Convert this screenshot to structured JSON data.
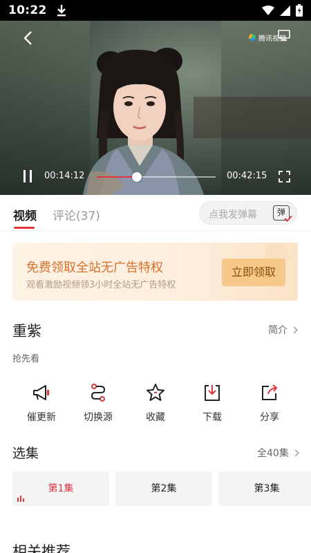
{
  "status_bar": {
    "time": "10:22"
  },
  "player": {
    "watermark": "腾讯视频",
    "current_time": "00:14:12",
    "total_time": "00:42:15",
    "progress_fraction": 0.336
  },
  "tabs": {
    "video": "视频",
    "comments": "评论(37)"
  },
  "danmu": {
    "placeholder": "点我发弹幕",
    "toggle_label": "弹"
  },
  "promo": {
    "title": "免费领取全站无广告特权",
    "subtitle": "观看激励视频领3小时全站无广告特权",
    "button": "立即领取"
  },
  "show": {
    "title": "重紫",
    "intro_link": "简介",
    "subtitle": "抢先看"
  },
  "actions": [
    {
      "label": "催更新",
      "icon": "megaphone-icon"
    },
    {
      "label": "切换源",
      "icon": "switch-source-icon"
    },
    {
      "label": "收藏",
      "icon": "star-icon"
    },
    {
      "label": "下载",
      "icon": "download-icon"
    },
    {
      "label": "分享",
      "icon": "share-icon"
    }
  ],
  "episodes": {
    "title": "选集",
    "all_link": "全40集",
    "items": [
      "第1集",
      "第2集",
      "第3集"
    ],
    "active_index": 0
  },
  "related": {
    "title": "相关推荐"
  },
  "colors": {
    "accent": "#e0343f",
    "promo_text": "#d9702a",
    "promo_button": "#f6c98a"
  }
}
